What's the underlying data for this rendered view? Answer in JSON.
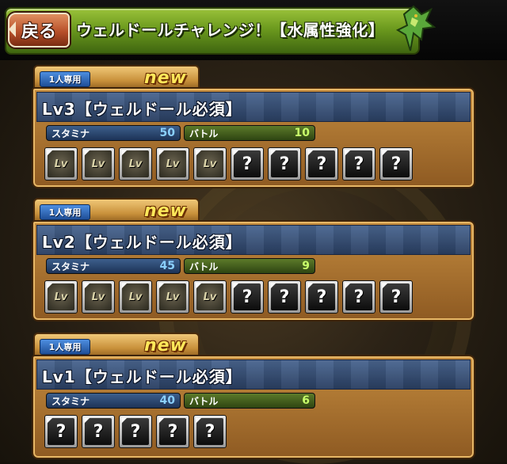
{
  "header": {
    "back_label": "戻る",
    "title": "ウェルドールチャレンジ！【水属性強化】"
  },
  "dungeons": [
    {
      "solo_label": "1人専用",
      "new_label": "new",
      "name": "Lv3【ウェルドール必須】",
      "stamina_label": "スタミナ",
      "stamina": "50",
      "battle_label": "バトル",
      "battles": "10",
      "slots": [
        "egg",
        "egg",
        "egg",
        "egg",
        "egg",
        "unknown",
        "unknown",
        "unknown",
        "unknown",
        "unknown"
      ]
    },
    {
      "solo_label": "1人専用",
      "new_label": "new",
      "name": "Lv2【ウェルドール必須】",
      "stamina_label": "スタミナ",
      "stamina": "45",
      "battle_label": "バトル",
      "battles": "9",
      "slots": [
        "egg",
        "egg",
        "egg",
        "egg",
        "egg",
        "unknown",
        "unknown",
        "unknown",
        "unknown",
        "unknown"
      ]
    },
    {
      "solo_label": "1人専用",
      "new_label": "new",
      "name": "Lv1【ウェルドール必須】",
      "stamina_label": "スタミナ",
      "stamina": "40",
      "battle_label": "バトル",
      "battles": "6",
      "slots": [
        "unknown",
        "unknown",
        "unknown",
        "unknown",
        "unknown"
      ]
    }
  ],
  "slot_glyphs": {
    "unknown": "?",
    "egg": "Lv"
  },
  "colors": {
    "header_green": "#6c9a1e",
    "card_gold": "#c28a3e",
    "name_bar_blue": "#2a3f62",
    "new_yellow": "#ffe85a"
  }
}
